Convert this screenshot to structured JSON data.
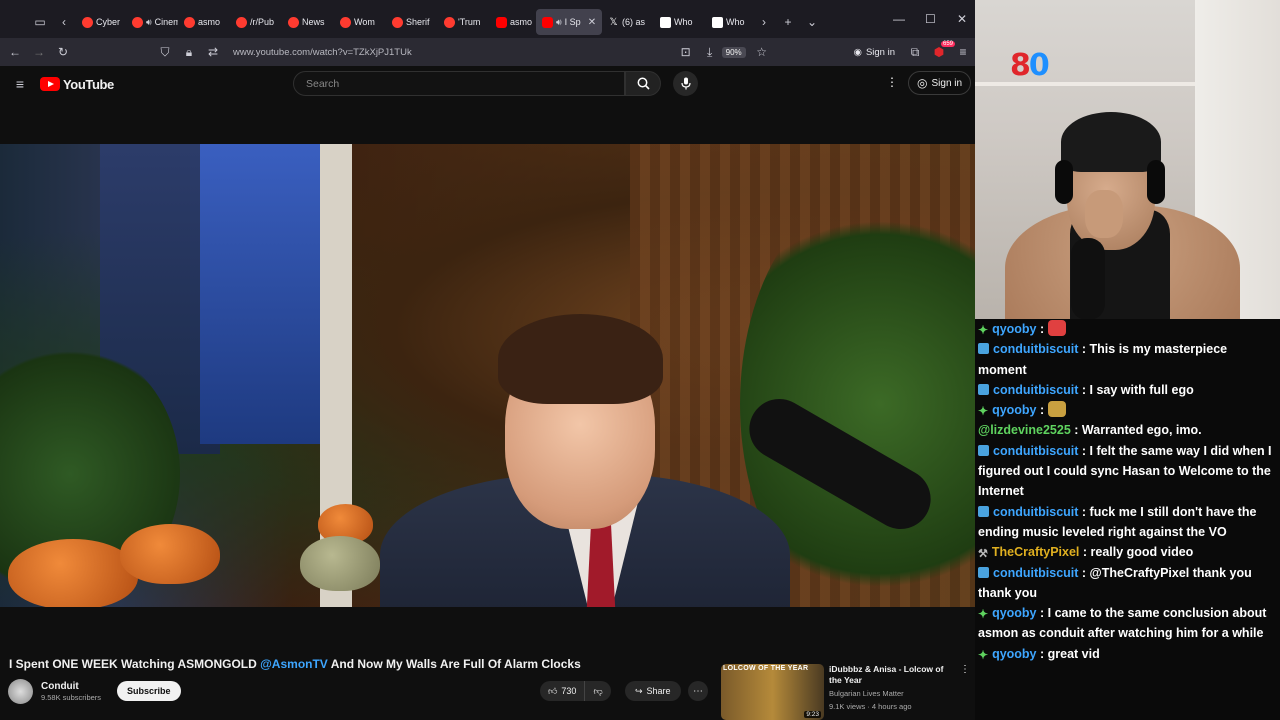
{
  "browser": {
    "tabs": [
      {
        "label": "Cyber",
        "fav": "red",
        "sound": false,
        "active": false
      },
      {
        "label": "Cinem",
        "fav": "red",
        "sound": true,
        "active": false
      },
      {
        "label": "asmo",
        "fav": "red",
        "sound": false,
        "active": false
      },
      {
        "label": "/r/Pub",
        "fav": "red",
        "sound": false,
        "active": false
      },
      {
        "label": "News",
        "fav": "red",
        "sound": false,
        "active": false
      },
      {
        "label": "Wom",
        "fav": "red",
        "sound": false,
        "active": false
      },
      {
        "label": "Sherif",
        "fav": "red",
        "sound": false,
        "active": false
      },
      {
        "label": "'Trum",
        "fav": "red",
        "sound": false,
        "active": false
      },
      {
        "label": "asmo",
        "fav": "yt",
        "sound": false,
        "active": false
      },
      {
        "label": "I Sp",
        "fav": "yt",
        "sound": true,
        "active": true
      },
      {
        "label": "(6) as",
        "fav": "x",
        "sound": false,
        "active": false
      },
      {
        "label": "Who",
        "fav": "w",
        "sound": false,
        "active": false
      },
      {
        "label": "Who",
        "fav": "w",
        "sound": false,
        "active": false
      }
    ],
    "url": "www.youtube.com/watch?v=TZkXjPJ1TUk",
    "zoom": "90%",
    "signin_label": "Sign in",
    "ext_badge": "659"
  },
  "youtube": {
    "logo_text": "YouTube",
    "search_placeholder": "Search",
    "signin_label": "Sign in"
  },
  "video": {
    "title_pre": "I Spent ONE WEEK Watching ASMONGOLD ",
    "title_mention": "@AsmonTV",
    "title_post": " And Now My Walls Are Full Of Alarm Clocks",
    "channel": "Conduit",
    "subscribers": "9.58K subscribers",
    "subscribe_label": "Subscribe",
    "likes": "730",
    "share_label": "Share"
  },
  "recommended": {
    "thumb_label": "LOLCOW OF THE YEAR",
    "duration": "9:23",
    "title": "iDubbbz & Anisa - Lolcow of the Year",
    "channel": "Bulgarian Lives Matter",
    "meta": "9.1K views · 4 hours ago"
  },
  "stream": {
    "counter_a": "8",
    "counter_b": "0"
  },
  "chat": [
    {
      "badge": "sparkle",
      "user": "qyooby",
      "color": "#3ea6ff",
      "text": "",
      "emote": "#e04040"
    },
    {
      "badge": "prime",
      "user": "conduitbiscuit",
      "color": "#3ea6ff",
      "text": "This is my masterpiece moment"
    },
    {
      "badge": "prime",
      "user": "conduitbiscuit",
      "color": "#3ea6ff",
      "text": "I say with full ego"
    },
    {
      "badge": "sparkle",
      "user": "qyooby",
      "color": "#3ea6ff",
      "text": "",
      "emote": "#c9a040"
    },
    {
      "badge": "",
      "user": "@lizdevine2525",
      "color": "#5fd35f",
      "text": "Warranted ego, imo."
    },
    {
      "badge": "prime",
      "user": "conduitbiscuit",
      "color": "#3ea6ff",
      "text": "I felt the same way I did when I figured out I could sync Hasan to Welcome to the Internet"
    },
    {
      "badge": "prime",
      "user": "conduitbiscuit",
      "color": "#3ea6ff",
      "text": "fuck me I still don't have the ending music leveled right against the VO"
    },
    {
      "badge": "tool",
      "user": "TheCraftyPixel",
      "color": "#e0b020",
      "text": "really good video"
    },
    {
      "badge": "prime",
      "user": "conduitbiscuit",
      "color": "#3ea6ff",
      "text": "@TheCraftyPixel thank you thank you"
    },
    {
      "badge": "sparkle",
      "user": "qyooby",
      "color": "#3ea6ff",
      "text": "I came to the same conclusion about asmon as conduit after watching him for a while"
    },
    {
      "badge": "sparkle",
      "user": "qyooby",
      "color": "#3ea6ff",
      "text": "great vid"
    }
  ]
}
